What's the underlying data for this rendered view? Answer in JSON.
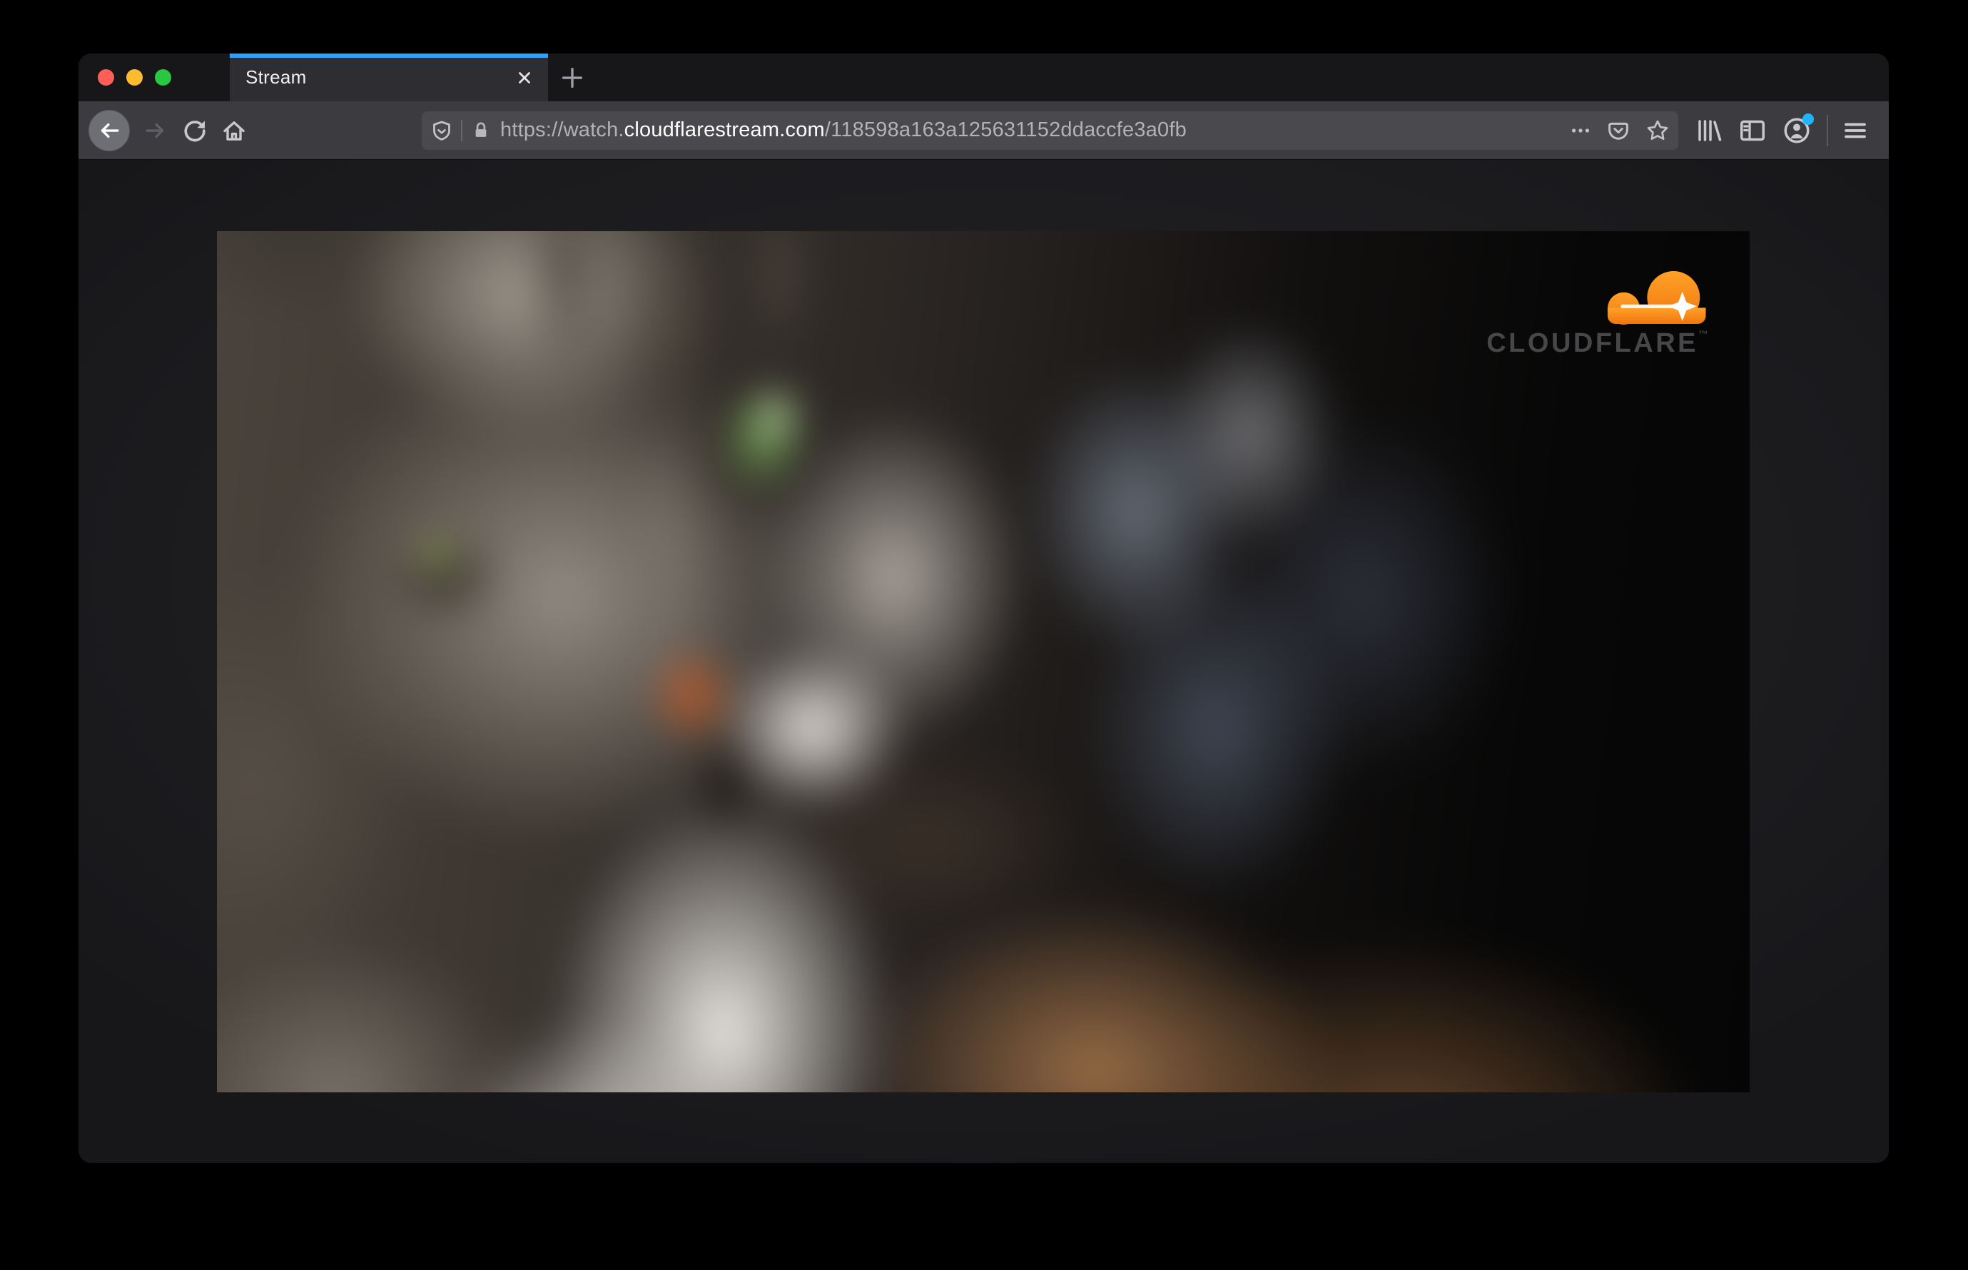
{
  "browser": {
    "window_controls": {
      "buttons": [
        "close",
        "minimize",
        "zoom"
      ]
    },
    "tab_bar": {
      "active_tab": {
        "title": "Stream"
      },
      "icons": [
        "tab-close-icon",
        "new-tab-icon"
      ]
    },
    "navigation": {
      "buttons": [
        "back",
        "forward",
        "reload",
        "home"
      ],
      "address_bar": {
        "url_prefix": "https://watch.",
        "url_domain": "cloudflarestream.com",
        "url_path": "/118598a163a125631152ddaccfe3a0fb",
        "url_full": "https://watch.cloudflarestream.com/118598a163a125631152ddaccfe3a0fb",
        "icons_left": [
          "tracking-protection-shield-icon",
          "lock-icon"
        ],
        "icons_right": [
          "page-actions-ellipsis-icon",
          "pocket-icon",
          "bookmark-star-icon"
        ]
      },
      "toolbar_icons_right": [
        "library-icon",
        "sidebar-icon",
        "account-icon",
        "menu-icon"
      ],
      "account_has_notification": true
    }
  },
  "page": {
    "video_player": {
      "brand_logo_text": "CLOUDFLARE",
      "brand_trademark": "™",
      "content_alt": "blurred close-up of a gray tabby cat with green eyes and an orange nose"
    }
  },
  "colors": {
    "active_tab_indicator": "#2f9fff",
    "cloudflare_orange": "#f7821c",
    "traffic_close_red": "#ff5f57",
    "traffic_minimize_yellow": "#febc2e",
    "traffic_zoom_green": "#28c840",
    "notification_blue": "#1db5ff",
    "toolbar_background": "#3c3c40",
    "urlbar_background": "#49494e",
    "titlebar_background": "#17171a"
  }
}
